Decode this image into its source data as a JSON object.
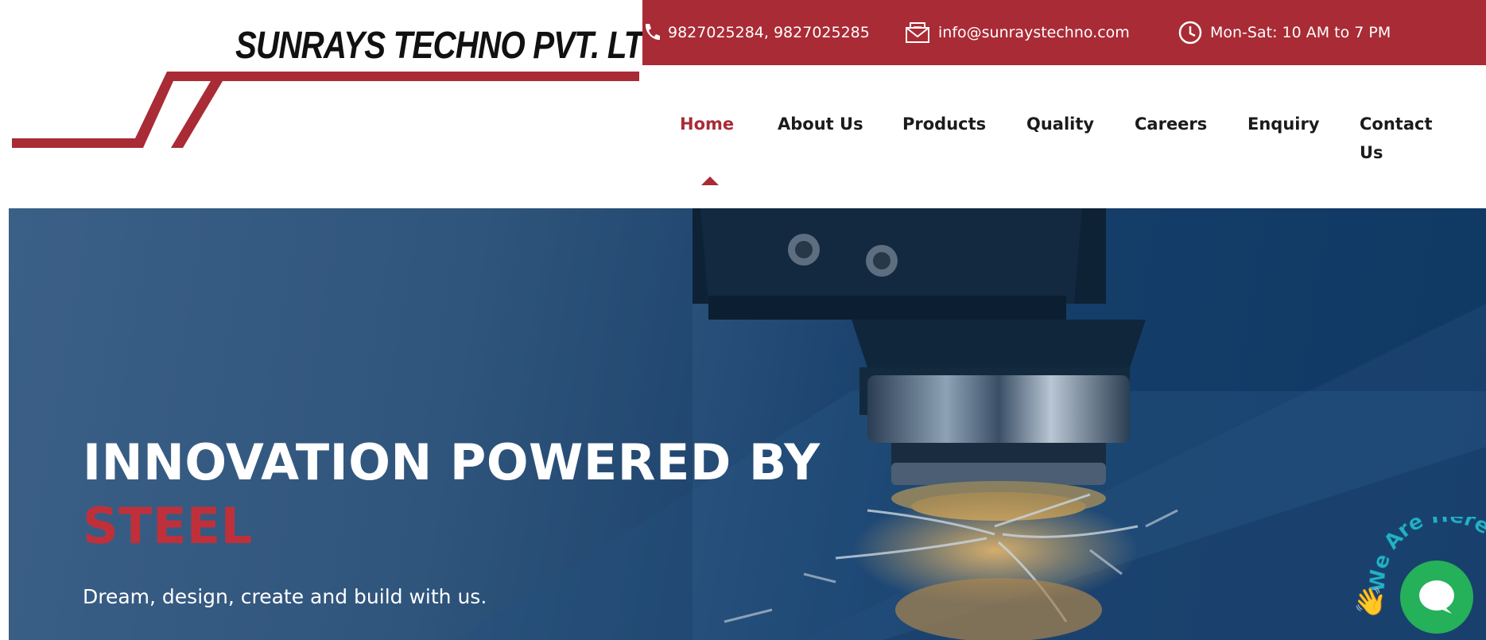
{
  "brand": {
    "name": "SUNRAYS TECHNO PVT. LTD"
  },
  "topbar": {
    "phone": "9827025284, 9827025285",
    "email": "info@sunraystechno.com",
    "hours": "Mon-Sat: 10 AM to 7 PM",
    "icons": [
      "phone-icon",
      "envelope-icon",
      "clock-icon"
    ]
  },
  "nav": {
    "items": [
      {
        "label": "Home",
        "active": true
      },
      {
        "label": "About Us"
      },
      {
        "label": "Products"
      },
      {
        "label": "Quality"
      },
      {
        "label": "Careers"
      },
      {
        "label": "Enquiry"
      },
      {
        "label": "Contact",
        "label_line2": "Us"
      }
    ]
  },
  "hero": {
    "title_line1": "INNOVATION POWERED BY",
    "title_accent": "STEEL",
    "subtitle": "Dream, design, create and build with us."
  },
  "chat": {
    "label": "We Are Here!",
    "emoji": "👋"
  },
  "colors": {
    "brand_red": "#a92b35",
    "hero_blue": "#173f6b",
    "chat_green": "#25b05a"
  }
}
